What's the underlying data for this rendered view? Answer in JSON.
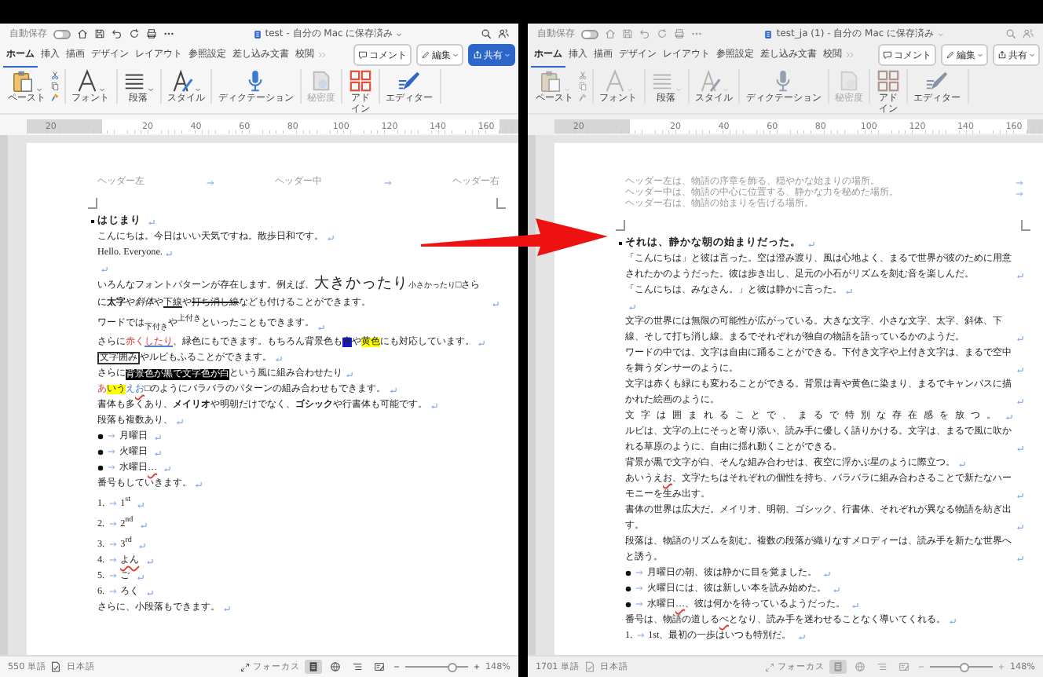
{
  "windows": [
    {
      "active": true,
      "autosave": {
        "label": "自動保存",
        "on": false
      },
      "title": "test - 自分の Mac に保存済み",
      "tabs": [
        {
          "label": "ホーム",
          "selected": true
        },
        {
          "label": "挿入",
          "selected": false
        },
        {
          "label": "描画",
          "selected": false
        },
        {
          "label": "デザイン",
          "selected": false
        },
        {
          "label": "レイアウト",
          "selected": false
        },
        {
          "label": "参照設定",
          "selected": false
        },
        {
          "label": "差し込み文書",
          "selected": false
        },
        {
          "label": "校閲",
          "selected": false
        }
      ],
      "comment_button": "コメント",
      "edit_button": "編集",
      "share_button": "共有",
      "ribbon": [
        {
          "kind": "paste",
          "label": "ペースト",
          "disabled": false
        },
        {
          "kind": "font",
          "label": "フォント",
          "disabled": false
        },
        {
          "kind": "paragraph",
          "label": "段落",
          "disabled": false
        },
        {
          "kind": "style",
          "label": "スタイル",
          "disabled": false
        },
        {
          "kind": "dictation",
          "label": "ディクテーション",
          "disabled": false
        },
        {
          "kind": "sensitivity",
          "label": "秘密度",
          "disabled": true
        },
        {
          "kind": "addin",
          "label": "アドイン",
          "disabled": false
        },
        {
          "kind": "editor",
          "label": "エディター",
          "disabled": false
        }
      ],
      "ruler_labels": [
        "20",
        "20",
        "40",
        "60",
        "80",
        "100",
        "120",
        "140",
        "160"
      ],
      "header": [
        "ヘッダー左",
        "ヘッダー中",
        "ヘッダー右"
      ],
      "paragraphs": [
        {
          "kind": "heading",
          "text": "はじまり"
        },
        {
          "kind": "body",
          "text": "こんにちは。今日はいい天気ですね。散歩日和です。"
        },
        {
          "kind": "body",
          "text": "Hello. Everyone."
        },
        {
          "kind": "blank"
        },
        {
          "kind": "body",
          "runs": [
            {
              "text": "いろんなフォントパターンが存在します。例えば、",
              "kind": "plain"
            },
            {
              "text": "大きかったり",
              "kind": "large"
            },
            {
              "text": "小さかったり",
              "kind": "small"
            },
            {
              "text": "□さらに",
              "kind": "plain"
            },
            {
              "text": "太字",
              "kind": "bold"
            },
            {
              "text": "や",
              "kind": "plain"
            },
            {
              "text": "斜体",
              "kind": "italic"
            },
            {
              "text": "や",
              "kind": "plain"
            },
            {
              "text": "下線",
              "kind": "underline"
            },
            {
              "text": "や",
              "kind": "plain"
            },
            {
              "text": "打ち消し線",
              "kind": "strike"
            },
            {
              "text": "なども付けることができます。",
              "kind": "plain"
            }
          ]
        },
        {
          "kind": "body",
          "text": "ワードでは$_{下付き}$や$^{上付き}$といったこともできます。"
        },
        {
          "kind": "body",
          "runs": [
            {
              "text": "さらに",
              "kind": "plain"
            },
            {
              "text": "赤く",
              "kind": "red"
            },
            {
              "text": "したり",
              "kind": "red-underlined"
            },
            {
              "text": "、緑色にもできます。もちろん背景色も",
              "kind": "plain"
            },
            {
              "text": "青",
              "kind": "blue-highlight"
            },
            {
              "text": "や",
              "kind": "plain"
            },
            {
              "text": "黄色",
              "kind": "yellow-highlight"
            },
            {
              "text": "にも対応しています。",
              "kind": "plain"
            }
          ]
        },
        {
          "kind": "body",
          "runs": [
            {
              "text": "文字囲み",
              "kind": "boxed"
            },
            {
              "text": "やルビもふることができます。",
              "kind": "plain"
            }
          ]
        },
        {
          "kind": "body",
          "runs": [
            {
              "text": "さらに",
              "kind": "plain"
            },
            {
              "text": "背景色が黒で文字色が白",
              "kind": "inverse"
            },
            {
              "text": "という風に組み合わせたり",
              "kind": "plain"
            }
          ]
        },
        {
          "kind": "body",
          "runs": [
            {
              "text": "あ",
              "kind": "red"
            },
            {
              "text": "いう",
              "kind": "yellow-highlight"
            },
            {
              "text": "え",
              "kind": "blue"
            },
            {
              "text": "お",
              "kind": "blue-wavy"
            },
            {
              "text": "□のようにバラバラのパターンの組み合わせもできます。",
              "kind": "plain"
            }
          ]
        },
        {
          "kind": "body",
          "runs": [
            {
              "text": "書体も多くあり、",
              "kind": "plain"
            },
            {
              "text": "メイリオ",
              "kind": "sans-bold"
            },
            {
              "text": "や明朝だけでなく、",
              "kind": "plain"
            },
            {
              "text": "ゴシック",
              "kind": "sans-bold"
            },
            {
              "text": "や行書体も可能です。",
              "kind": "plain"
            }
          ]
        },
        {
          "kind": "body",
          "text": "段落も複数あり、"
        },
        {
          "kind": "bullet",
          "text": "月曜日"
        },
        {
          "kind": "bullet",
          "text": "火曜日"
        },
        {
          "kind": "bullet",
          "runs": [
            {
              "text": "水曜日",
              "kind": "plain"
            },
            {
              "text": "…",
              "kind": "wavy"
            }
          ]
        },
        {
          "kind": "body",
          "text": "番号もしていきます。"
        },
        {
          "kind": "numbered",
          "number": "1.",
          "text": "1$^{st}$"
        },
        {
          "kind": "numbered",
          "number": "2.",
          "text": "2$^{nd}$"
        },
        {
          "kind": "numbered",
          "number": "3.",
          "text": "3$^{rd}$"
        },
        {
          "kind": "numbered",
          "number": "4.",
          "runs": [
            {
              "text": "よん",
              "kind": "wavy"
            }
          ]
        },
        {
          "kind": "numbered",
          "number": "5.",
          "text": "ご"
        },
        {
          "kind": "numbered",
          "number": "6.",
          "text": "ろく"
        },
        {
          "kind": "body",
          "text": "さらに、小段落もできます。"
        }
      ],
      "status": {
        "word_count": "550 単語",
        "language": "日本語",
        "focus": "フォーカス",
        "views": [
          {
            "selected": true
          },
          {
            "selected": false
          },
          {
            "selected": false
          },
          {
            "selected": false
          }
        ],
        "zoom_slider": {
          "level": 0.75
        },
        "zoom": "148%"
      }
    },
    {
      "active": false,
      "autosave": {
        "label": "自動保存",
        "on": false
      },
      "title": "test_ja (1) - 自分の Mac に保存済み",
      "tabs": [
        {
          "label": "ホーム",
          "selected": true
        },
        {
          "label": "挿入",
          "selected": false
        },
        {
          "label": "描画",
          "selected": false
        },
        {
          "label": "デザイン",
          "selected": false
        },
        {
          "label": "レイアウト",
          "selected": false
        },
        {
          "label": "参照設定",
          "selected": false
        },
        {
          "label": "差し込み文書",
          "selected": false
        },
        {
          "label": "校閲",
          "selected": false
        }
      ],
      "comment_button": "コメント",
      "edit_button": "編集",
      "share_button": "共有",
      "ribbon": [
        {
          "kind": "paste",
          "label": "ペースト",
          "disabled": false
        },
        {
          "kind": "font",
          "label": "フォント",
          "disabled": false
        },
        {
          "kind": "paragraph",
          "label": "段落",
          "disabled": false
        },
        {
          "kind": "style",
          "label": "スタイル",
          "disabled": false
        },
        {
          "kind": "dictation",
          "label": "ディクテーション",
          "disabled": false
        },
        {
          "kind": "sensitivity",
          "label": "秘密度",
          "disabled": true
        },
        {
          "kind": "addin",
          "label": "アドイン",
          "disabled": false
        },
        {
          "kind": "editor",
          "label": "エディター",
          "disabled": false
        }
      ],
      "ruler_labels": [
        "20",
        "20",
        "40",
        "60",
        "80",
        "100",
        "120",
        "140",
        "160"
      ],
      "header": [
        "ヘッダー左は、物語の序章を飾る、穏やかな始まりの場所。",
        "ヘッダー中は、物語の中心に位置する、静かな力を秘めた場所。",
        "ヘッダー右は、物語の始まりを告げる場所。"
      ],
      "paragraphs": [
        {
          "kind": "heading",
          "text": "それは、静かな朝の始まりだった。"
        },
        {
          "kind": "body",
          "text": "「こんにちは」と彼は言った。空は澄み渡り、風は心地よく、まるで世界が彼のために用意されたかのようだった。彼は歩き出し、足元の小石がリズムを刻む音を楽しんだ。"
        },
        {
          "kind": "body",
          "text": "「こんにちは、みなさん。」と彼は静かに言った。"
        },
        {
          "kind": "blank"
        },
        {
          "kind": "body",
          "text": "文字の世界には無限の可能性が広がっている。大きな文字、小さな文字、太字、斜体、下線、そして打ち消し線。まるでそれぞれが独自の物語を語っているかのようだ。"
        },
        {
          "kind": "body",
          "text": "ワードの中では、文字は自由に踊ることができる。下付き文字や上付き文字は、まるで空中を舞うダンサーのように。"
        },
        {
          "kind": "body",
          "text": "文字は赤くも緑にも変わることができる。背景は青や黄色に染まり、まるでキャンバスに描かれた絵画のように。"
        },
        {
          "kind": "body",
          "runs": [
            {
              "text": "文字は囲まれることで、まるで特別な存在感を放つ。",
              "kind": "spaced"
            }
          ]
        },
        {
          "kind": "body",
          "text": "ルビは、文字の上にそっと寄り添い、読み手に優しく語りかける。文字は、まるで風に吹かれる草原のように、自由に揺れ動くことができる。"
        },
        {
          "kind": "body",
          "text": "背景が黒で文字が白、そんな組み合わせは、夜空に浮かぶ星のように際立つ。"
        },
        {
          "kind": "body",
          "runs": [
            {
              "text": "あいうえ",
              "kind": "plain"
            },
            {
              "text": "お",
              "kind": "wavy"
            },
            {
              "text": "、文字たちはそれぞれの個性を持ち、バラバラに組み合わさることで新たなハーモニーを生み出す。",
              "kind": "plain"
            }
          ]
        },
        {
          "kind": "body",
          "text": "書体の世界は広大だ。メイリオ、明朝、ゴシック、行書体、それぞれが異なる物語を紡ぎ出す。"
        },
        {
          "kind": "body",
          "text": "段落は、物語のリズムを刻む。複数の段落が織りなすメロディーは、読み手を新たな世界へと誘う。"
        },
        {
          "kind": "bullet",
          "text": "月曜日の朝、彼は静かに目を覚ました。"
        },
        {
          "kind": "bullet",
          "text": "火曜日には、彼は新しい本を読み始めた。"
        },
        {
          "kind": "bullet",
          "runs": [
            {
              "text": "水曜日",
              "kind": "plain"
            },
            {
              "text": "…",
              "kind": "wavy"
            },
            {
              "text": "、彼は何かを待っているようだった。",
              "kind": "plain"
            }
          ]
        },
        {
          "kind": "body",
          "runs": [
            {
              "text": "番号は、物語の道しる",
              "kind": "plain"
            },
            {
              "text": "べ",
              "kind": "wavy"
            },
            {
              "text": "となり、読み手を迷わせることなく導いてくれる。",
              "kind": "plain"
            }
          ]
        },
        {
          "kind": "numbered",
          "number": "1.",
          "text": "1st、最初の一歩はいつも特別だ。"
        }
      ],
      "status": {
        "word_count": "1701 単語",
        "language": "日本語",
        "focus": "フォーカス",
        "views": [
          {
            "selected": true
          },
          {
            "selected": false
          },
          {
            "selected": false
          },
          {
            "selected": false
          }
        ],
        "zoom_slider": {
          "level": 0.55
        },
        "zoom": "148%"
      }
    }
  ]
}
